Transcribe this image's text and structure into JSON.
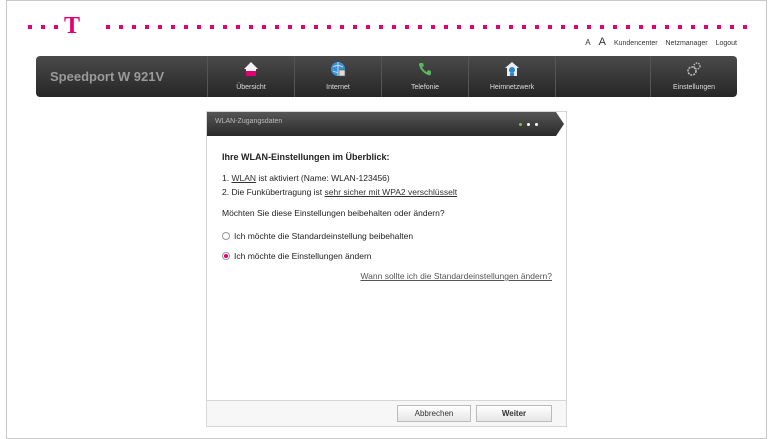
{
  "header": {
    "logo_letter": "T",
    "font_small": "A",
    "font_large": "A",
    "links": [
      "Kundencenter",
      "Netzmanager",
      "Logout"
    ]
  },
  "navbar": {
    "product": "Speedport W 921V",
    "items": [
      {
        "label": "Übersicht",
        "icon": "home-icon"
      },
      {
        "label": "Internet",
        "icon": "globe-icon"
      },
      {
        "label": "Telefonie",
        "icon": "phone-icon"
      },
      {
        "label": "Heimnetzwerk",
        "icon": "network-house-icon"
      },
      {
        "label": "Einstellungen",
        "icon": "gears-icon"
      }
    ]
  },
  "panel": {
    "title": "WLAN-Zugangsdaten",
    "heading": "Ihre WLAN-Einstellungen im Überblick:",
    "line1_prefix": "1.",
    "line1_link": "WLAN",
    "line1_text": "ist aktiviert (Name: WLAN-123456)",
    "line2_text": "2. Die Funkübertragung ist",
    "line2_link": "sehr sicher mit WPA2 verschlüsselt",
    "question": "Möchten Sie diese Einstellungen beibehalten oder ändern?",
    "option_keep": "Ich möchte die Standardeinstellung beibehalten",
    "option_change": "Ich möchte die Einstellungen ändern",
    "help_link": "Wann sollte ich die Standardeinstellungen ändern?",
    "selected_option": "change"
  },
  "buttons": {
    "cancel": "Abbrechen",
    "next": "Weiter"
  },
  "colors": {
    "brand": "#e20074",
    "step_active": "#7cc242"
  }
}
